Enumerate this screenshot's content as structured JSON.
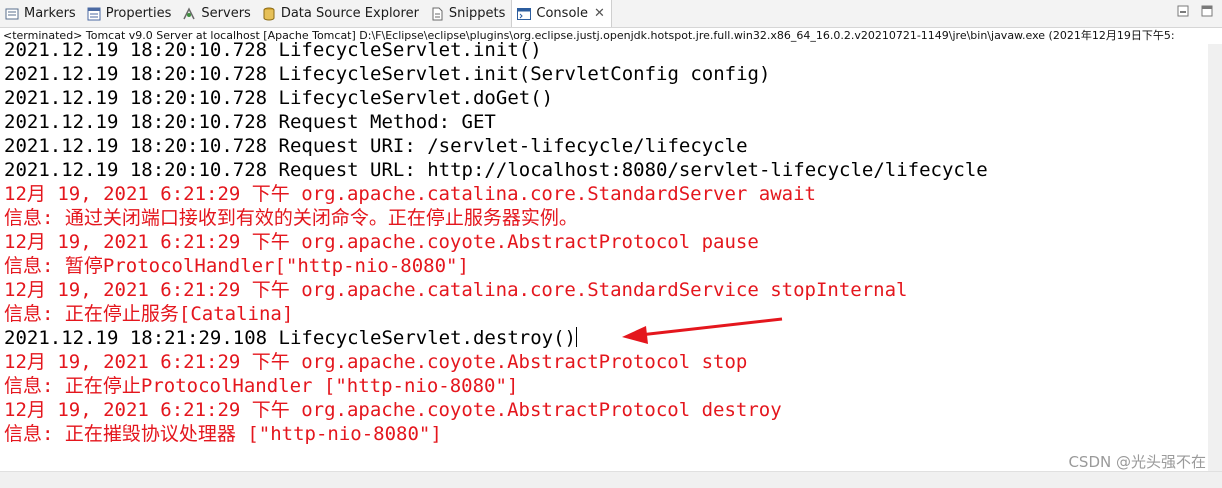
{
  "tabs": [
    {
      "label": "Markers"
    },
    {
      "label": "Properties"
    },
    {
      "label": "Servers"
    },
    {
      "label": "Data Source Explorer"
    },
    {
      "label": "Snippets"
    },
    {
      "label": "Console",
      "close": "✕"
    }
  ],
  "status": "<terminated> Tomcat v9.0 Server at localhost [Apache Tomcat] D:\\F\\Eclipse\\eclipse\\plugins\\org.eclipse.justj.openjdk.hotspot.jre.full.win32.x86_64_16.0.2.v20210721-1149\\jre\\bin\\javaw.exe  (2021年12月19日下午5:",
  "console_lines": [
    {
      "text": "2021.12.19 18:20:10.728 LifecycleServlet.init()",
      "color": "black"
    },
    {
      "text": "2021.12.19 18:20:10.728 LifecycleServlet.init(ServletConfig config)",
      "color": "black"
    },
    {
      "text": "2021.12.19 18:20:10.728 LifecycleServlet.doGet()",
      "color": "black"
    },
    {
      "text": "2021.12.19 18:20:10.728 Request Method: GET",
      "color": "black"
    },
    {
      "text": "2021.12.19 18:20:10.728 Request URI: /servlet-lifecycle/lifecycle",
      "color": "black"
    },
    {
      "text": "2021.12.19 18:20:10.728 Request URL: http://localhost:8080/servlet-lifecycle/lifecycle",
      "color": "black"
    },
    {
      "text": "12月 19, 2021 6:21:29 下午 org.apache.catalina.core.StandardServer await",
      "color": "red"
    },
    {
      "text": "信息: 通过关闭端口接收到有效的关闭命令。正在停止服务器实例。",
      "color": "red"
    },
    {
      "text": "12月 19, 2021 6:21:29 下午 org.apache.coyote.AbstractProtocol pause",
      "color": "red"
    },
    {
      "text": "信息: 暂停ProtocolHandler[\"http-nio-8080\"]",
      "color": "red"
    },
    {
      "text": "12月 19, 2021 6:21:29 下午 org.apache.catalina.core.StandardService stopInternal",
      "color": "red"
    },
    {
      "text": "信息: 正在停止服务[Catalina]",
      "color": "red"
    },
    {
      "text": "2021.12.19 18:21:29.108 LifecycleServlet.destroy()",
      "color": "black"
    },
    {
      "text": "12月 19, 2021 6:21:29 下午 org.apache.coyote.AbstractProtocol stop",
      "color": "red"
    },
    {
      "text": "信息: 正在停止ProtocolHandler [\"http-nio-8080\"]",
      "color": "red"
    },
    {
      "text": "12月 19, 2021 6:21:29 下午 org.apache.coyote.AbstractProtocol destroy",
      "color": "red"
    },
    {
      "text": "信息: 正在摧毁协议处理器 [\"http-nio-8080\"]",
      "color": "red"
    }
  ],
  "watermark": "CSDN @光头强不在",
  "colors": {
    "stderr": "#e4161d",
    "stdout": "#000000",
    "annotation_arrow": "#e4161d"
  }
}
